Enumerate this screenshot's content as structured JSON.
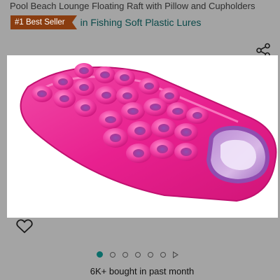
{
  "product": {
    "title": "Pool Beach Lounge Floating Raft with Pillow and Cupholders",
    "badge": "#1 Best Seller",
    "category": "in Fishing Soft Plastic Lures",
    "social_proof": "6K+ bought in past month"
  },
  "icons": {
    "share": "share-icon",
    "wishlist": "heart-outline-icon",
    "video": "play-icon"
  },
  "gallery": {
    "image_count": 6,
    "active_index": 0,
    "has_video": true
  },
  "colors": {
    "background": "#a4a4a4",
    "badge": "#8a3d10",
    "category_link": "#0b4a4a",
    "active_dot": "#0b6e6a",
    "raft": "#e81f8c"
  }
}
